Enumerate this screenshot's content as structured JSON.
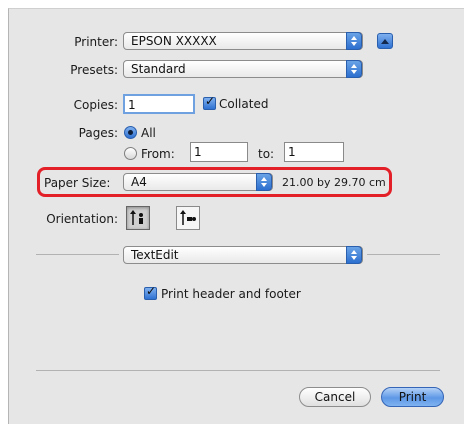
{
  "printer": {
    "label": "Printer:",
    "value": "EPSON XXXXX"
  },
  "presets": {
    "label": "Presets:",
    "value": "Standard"
  },
  "copies": {
    "label": "Copies:",
    "value": "1",
    "collated_label": "Collated",
    "collated_checked": true
  },
  "pages": {
    "label": "Pages:",
    "all_label": "All",
    "from_label": "From:",
    "from_value": "1",
    "to_label": "to:",
    "to_value": "1",
    "selected": "All"
  },
  "paper_size": {
    "label": "Paper Size:",
    "value": "A4",
    "dimensions": "21.00 by 29.70 cm"
  },
  "orientation": {
    "label": "Orientation:",
    "selected": "portrait"
  },
  "section": {
    "value": "TextEdit"
  },
  "header_footer": {
    "label": "Print header and footer",
    "checked": true
  },
  "buttons": {
    "cancel": "Cancel",
    "print": "Print"
  },
  "colors": {
    "highlight": "#e32028",
    "accent": "#2f72d2"
  }
}
